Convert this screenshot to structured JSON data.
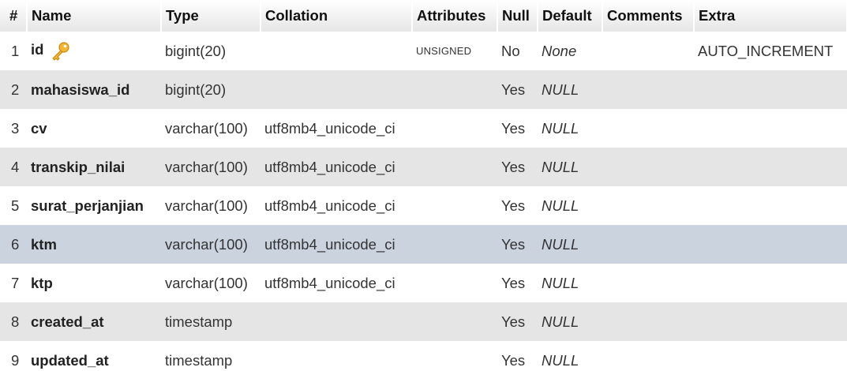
{
  "header": {
    "num": "#",
    "name": "Name",
    "type": "Type",
    "collation": "Collation",
    "attributes": "Attributes",
    "null": "Null",
    "default": "Default",
    "comments": "Comments",
    "extra": "Extra"
  },
  "rows": [
    {
      "num": "1",
      "name": "id",
      "primary_key_icon": "key-icon",
      "type": "bigint(20)",
      "collation": "",
      "attributes": "UNSIGNED",
      "null": "No",
      "default": "None",
      "comments": "",
      "extra": "AUTO_INCREMENT"
    },
    {
      "num": "2",
      "name": "mahasiswa_id",
      "type": "bigint(20)",
      "collation": "",
      "attributes": "",
      "null": "Yes",
      "default": "NULL",
      "comments": "",
      "extra": ""
    },
    {
      "num": "3",
      "name": "cv",
      "type": "varchar(100)",
      "collation": "utf8mb4_unicode_ci",
      "attributes": "",
      "null": "Yes",
      "default": "NULL",
      "comments": "",
      "extra": ""
    },
    {
      "num": "4",
      "name": "transkip_nilai",
      "type": "varchar(100)",
      "collation": "utf8mb4_unicode_ci",
      "attributes": "",
      "null": "Yes",
      "default": "NULL",
      "comments": "",
      "extra": ""
    },
    {
      "num": "5",
      "name": "surat_perjanjian",
      "type": "varchar(100)",
      "collation": "utf8mb4_unicode_ci",
      "attributes": "",
      "null": "Yes",
      "default": "NULL",
      "comments": "",
      "extra": ""
    },
    {
      "num": "6",
      "name": "ktm",
      "type": "varchar(100)",
      "collation": "utf8mb4_unicode_ci",
      "attributes": "",
      "null": "Yes",
      "default": "NULL",
      "comments": "",
      "extra": "",
      "highlighted": true
    },
    {
      "num": "7",
      "name": "ktp",
      "type": "varchar(100)",
      "collation": "utf8mb4_unicode_ci",
      "attributes": "",
      "null": "Yes",
      "default": "NULL",
      "comments": "",
      "extra": ""
    },
    {
      "num": "8",
      "name": "created_at",
      "type": "timestamp",
      "collation": "",
      "attributes": "",
      "null": "Yes",
      "default": "NULL",
      "comments": "",
      "extra": ""
    },
    {
      "num": "9",
      "name": "updated_at",
      "type": "timestamp",
      "collation": "",
      "attributes": "",
      "null": "Yes",
      "default": "NULL",
      "comments": "",
      "extra": ""
    }
  ],
  "colors": {
    "row_odd": "#ffffff",
    "row_even": "#e5e5e5",
    "row_highlight": "#cbd3df",
    "key_icon": "#f2b632"
  }
}
